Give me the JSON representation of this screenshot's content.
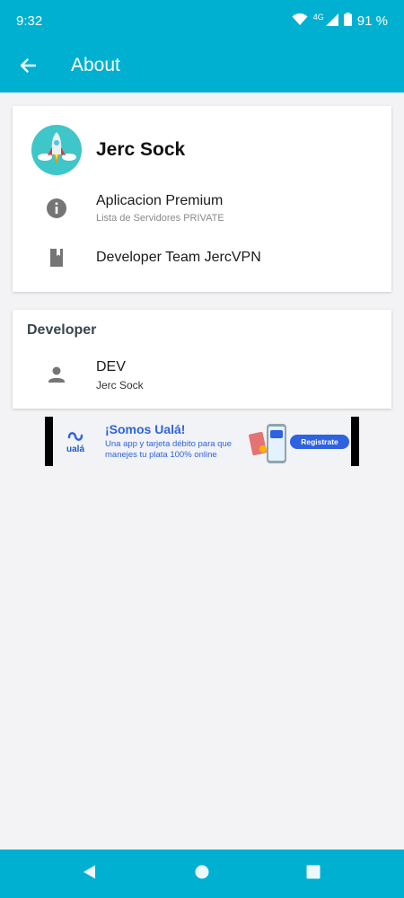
{
  "status_bar": {
    "time": "9:32",
    "network": "4G",
    "battery": "91 %"
  },
  "app_bar": {
    "title": "About",
    "back_icon": "arrow-left-icon"
  },
  "app_card": {
    "app_name": "Jerc Sock",
    "items": [
      {
        "icon": "info-icon",
        "title": "Aplicacion Premium",
        "subtitle": "Lista de Servidores PRIVATE"
      },
      {
        "icon": "book-icon",
        "title": "Developer Team JercVPN"
      }
    ]
  },
  "developer_card": {
    "heading": "Developer",
    "items": [
      {
        "icon": "person-icon",
        "title": "DEV",
        "subtitle": "Jerc Sock"
      }
    ]
  },
  "ad_banner": {
    "brand": "ualá",
    "headline": "¡Somos Ualá!",
    "line1": "Una app y tarjeta débito para que",
    "line2": "manejes tu plata 100% online",
    "cta": "Registrate"
  },
  "nav_bar": {
    "back": "nav-back-icon",
    "home": "nav-home-icon",
    "recents": "nav-recents-icon"
  },
  "colors": {
    "primary": "#00b0d1",
    "background": "#f3f3f5",
    "card": "#ffffff",
    "ad_accent": "#2f62e0"
  }
}
